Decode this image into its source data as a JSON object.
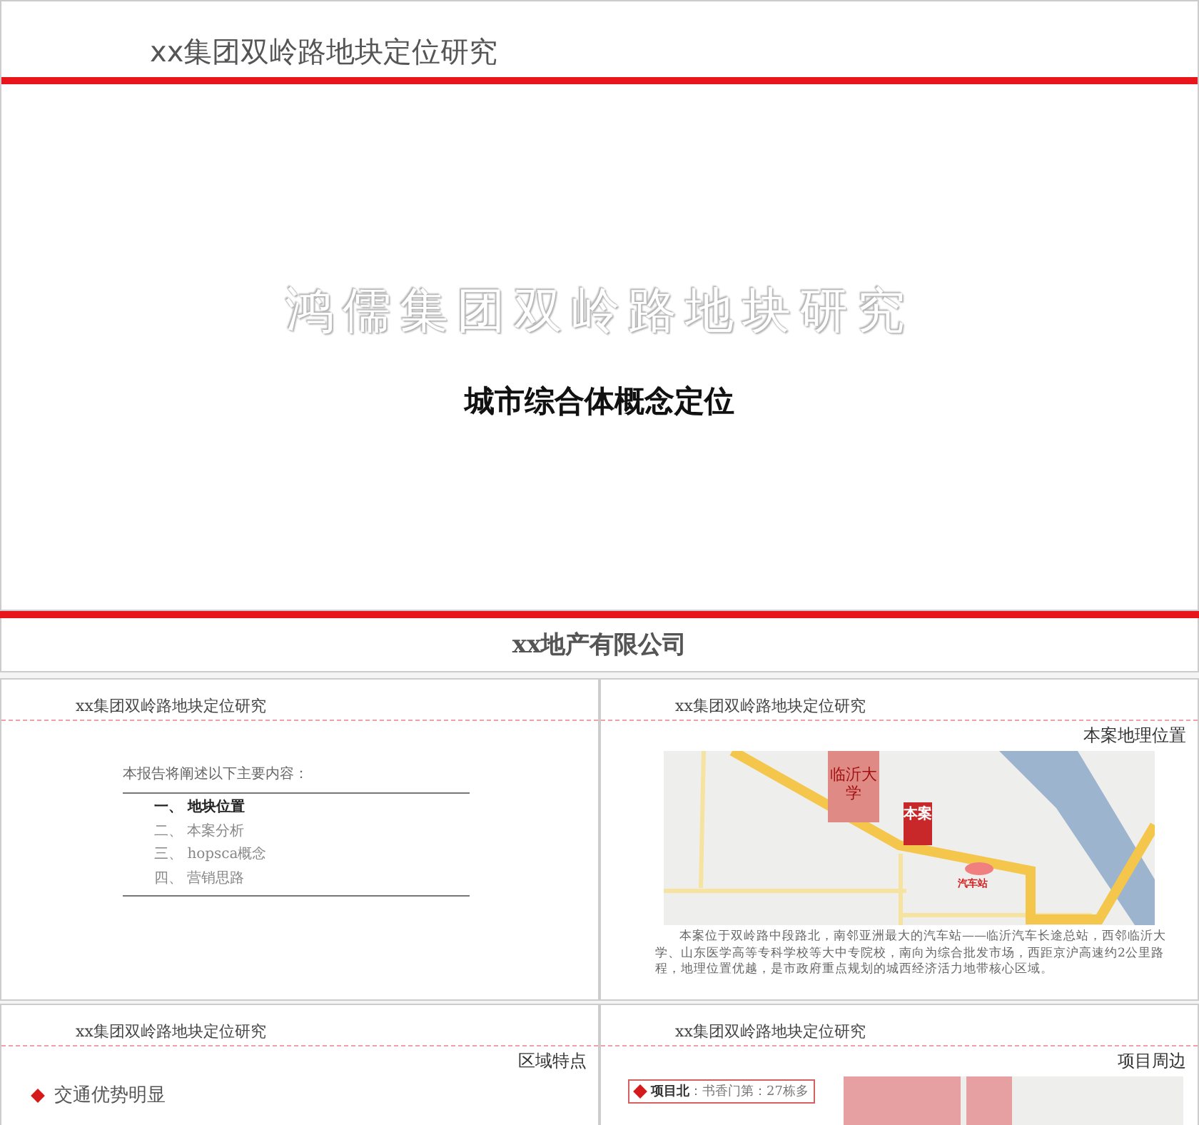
{
  "cover": {
    "header": "xx集团双岭路地块定位研究",
    "title": "鸿儒集团双岭路地块研究",
    "subtitle": "城市综合体概念定位",
    "company": "xx地产有限公司"
  },
  "slides": [
    {
      "kind": "contents",
      "header": "xx集团双岭路地块定位研究",
      "intro": "本报告将阐述以下主要内容：",
      "items": [
        {
          "number": "一、",
          "label": "地块位置",
          "selected": true
        },
        {
          "number": "二、",
          "label": "本案分析",
          "selected": false
        },
        {
          "number": "三、",
          "label": "hopsca概念",
          "selected": false
        },
        {
          "number": "四、",
          "label": "营销思路",
          "selected": false
        }
      ]
    },
    {
      "kind": "map",
      "header": "xx集团双岭路地块定位研究",
      "section": "本案地理位置",
      "map_labels": {
        "university": "临沂大学",
        "site": "本案",
        "station": "汽车站"
      },
      "caption": "本案位于双岭路中段路北，南邻亚洲最大的汽车站——临沂汽车长途总站，西邻临沂大学、山东医学高等专科学校等大中专院校，南向为综合批发市场，西距京沪高速约2公里路程，地理位置优越，是市政府重点规划的城西经济活力地带核心区域。"
    },
    {
      "kind": "bullets",
      "header": "xx集团双岭路地块定位研究",
      "section": "区域特点",
      "bullets": [
        "交通优势明显"
      ]
    },
    {
      "kind": "surroundings",
      "header": "xx集团双岭路地块定位研究",
      "section": "项目周边",
      "callout": "**项目北**：书香门第：27栋多"
    }
  ]
}
